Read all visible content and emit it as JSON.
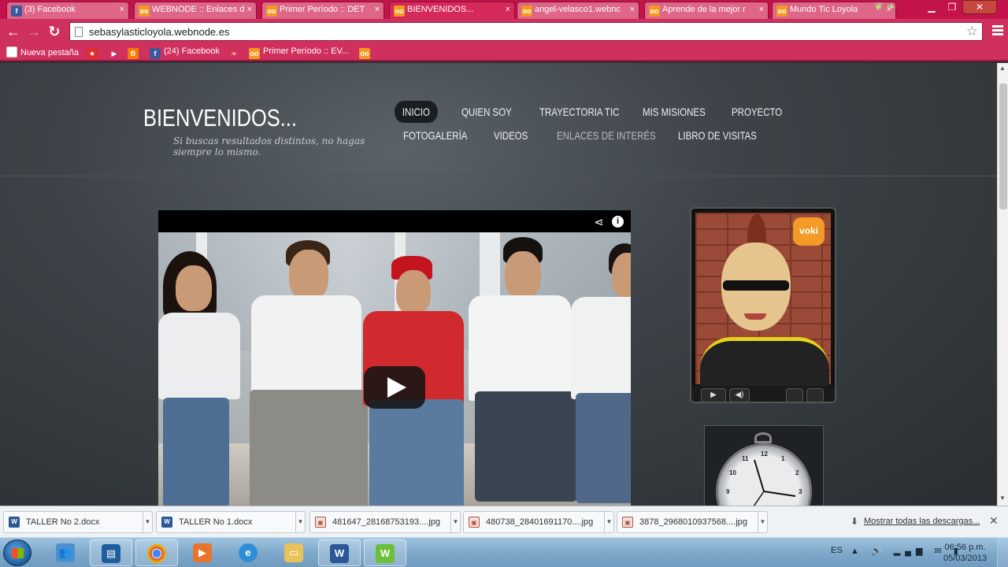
{
  "browser": {
    "tabs": [
      {
        "label": "(3) Facebook",
        "favicon": "facebook-icon"
      },
      {
        "label": "WEBNODE :: Enlaces d",
        "favicon": "owl-icon"
      },
      {
        "label": "Primer Período :: DET",
        "favicon": "owl-icon"
      },
      {
        "label": "BIENVENIDOS...",
        "favicon": "owl-icon",
        "active": true
      },
      {
        "label": "angel-velasco1.webnc",
        "favicon": "owl-icon"
      },
      {
        "label": "Aprende de la mejor r",
        "favicon": "owl-icon"
      },
      {
        "label": "Mundo Tic Loyola",
        "favicon": "owl-icon"
      }
    ],
    "close_glyph": "×",
    "address": "sebasylasticloyola.webnode.es",
    "bookmarks": [
      {
        "label": "Nueva pestaña",
        "icon": "page-icon"
      },
      {
        "label": "",
        "icon": "star-icon"
      },
      {
        "label": "",
        "icon": "youtube-icon"
      },
      {
        "label": "",
        "icon": "blogger-icon"
      },
      {
        "label": "(24) Facebook",
        "icon": "facebook-icon"
      },
      {
        "label": "",
        "icon": "bird-icon"
      },
      {
        "label": "Primer Período :: EV...",
        "icon": "owl-icon"
      },
      {
        "label": "",
        "icon": "owl-icon"
      }
    ]
  },
  "site": {
    "title": "BIENVENIDOS...",
    "subtitle": "Si buscas resultados distintos, no hagas siempre lo mismo.",
    "menu": [
      {
        "label": "INICIO",
        "active": true
      },
      {
        "label": "QUIEN SOY"
      },
      {
        "label": "TRAYECTORIA TIC"
      },
      {
        "label": "MIS MISIONES"
      },
      {
        "label": "PROYECTO"
      },
      {
        "label": "FOTOGALERÍA"
      },
      {
        "label": "VIDEOS"
      },
      {
        "label": "ENLACES DE INTERÉS"
      },
      {
        "label": "LIBRO DE VISITAS"
      }
    ],
    "voki_logo": "voki",
    "clock_numbers": [
      "12",
      "1",
      "2",
      "3",
      "9",
      "10",
      "11"
    ]
  },
  "downloads": {
    "items": [
      {
        "name": "TALLER No 2.docx",
        "type": "word"
      },
      {
        "name": "TALLER No 1.docx",
        "type": "word"
      },
      {
        "name": "481647_28168753193....jpg",
        "type": "jpg"
      },
      {
        "name": "480738_28401691170....jpg",
        "type": "jpg"
      },
      {
        "name": "3878_2968010937568....jpg",
        "type": "jpg"
      }
    ],
    "show_all": "Mostrar todas las descargas..."
  },
  "taskbar": {
    "language": "ES",
    "time": "06:56 p.m.",
    "date": "05/03/2013"
  },
  "colors": {
    "chrome_theme": "#d0305e",
    "page_background": "#3d4348"
  }
}
